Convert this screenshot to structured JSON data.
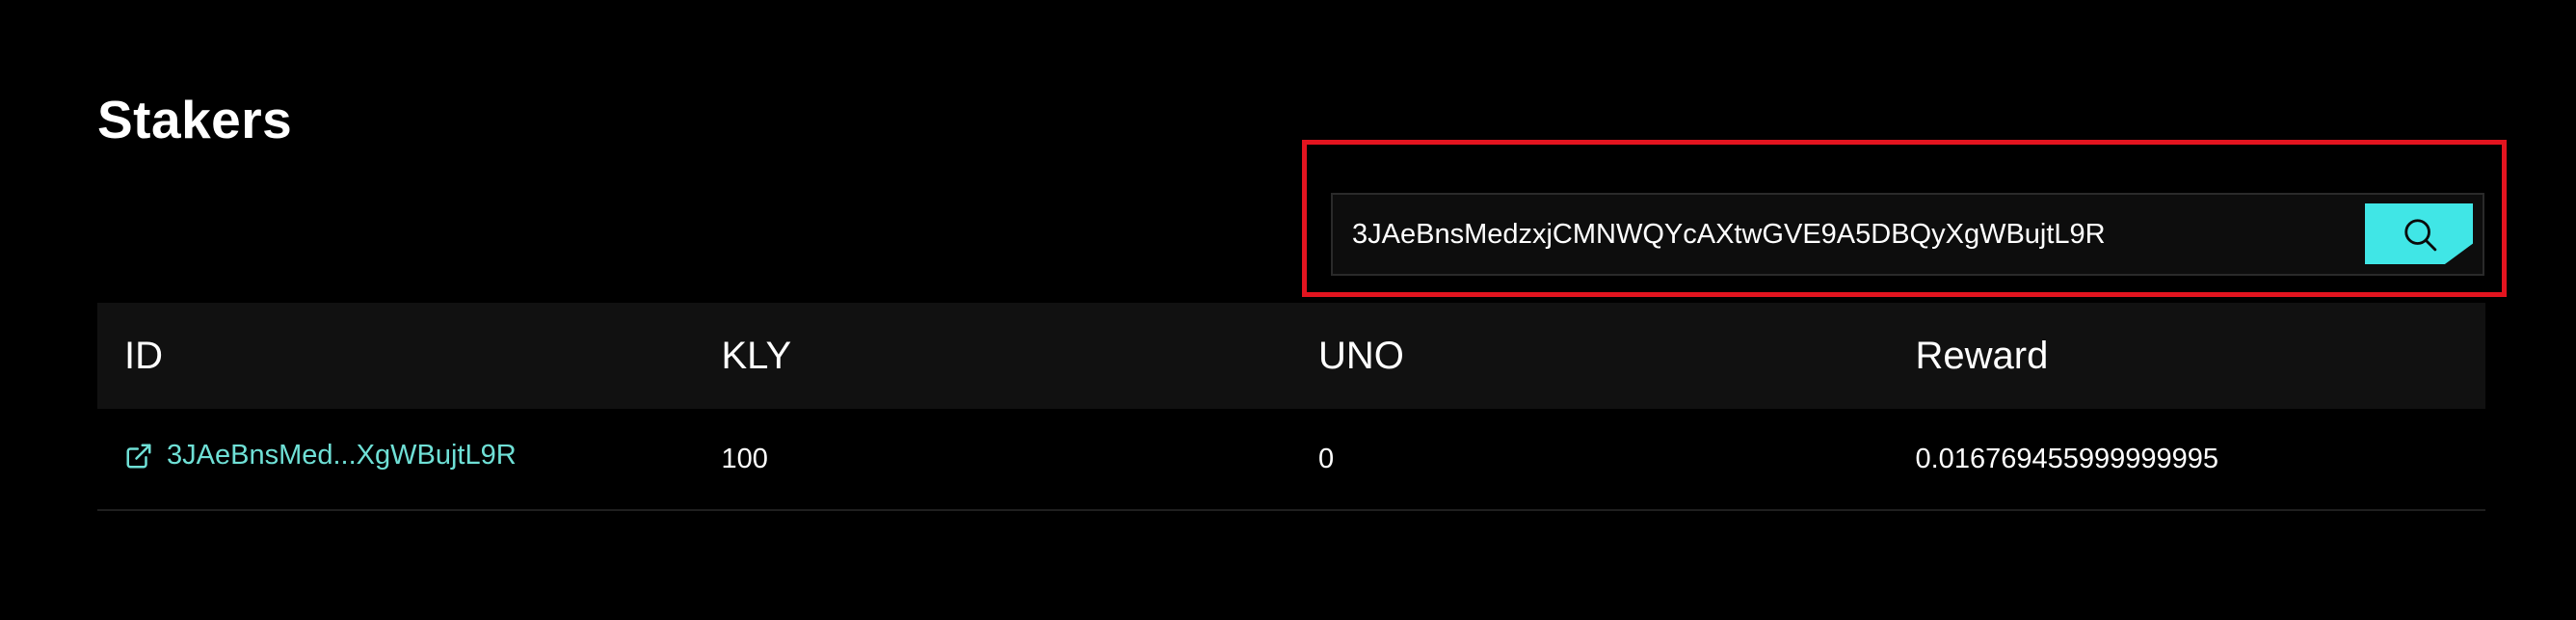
{
  "page": {
    "title": "Stakers"
  },
  "search": {
    "value": "3JAeBnsMedzxjCMNWQYcAXtwGVE9A5DBQyXgWBujtL9R",
    "button_icon": "search-icon"
  },
  "table": {
    "headers": [
      "ID",
      "KLY",
      "UNO",
      "Reward"
    ],
    "rows": [
      {
        "id": "3JAeBnsMed...XgWBujtL9R",
        "id_icon": "external-link-icon",
        "kly": "100",
        "uno": "0",
        "reward": "0.016769455999999995"
      }
    ]
  },
  "colors": {
    "background": "#000000",
    "accent": "#40e6e6",
    "link": "#6fe0d6",
    "highlight": "#e3141f"
  }
}
